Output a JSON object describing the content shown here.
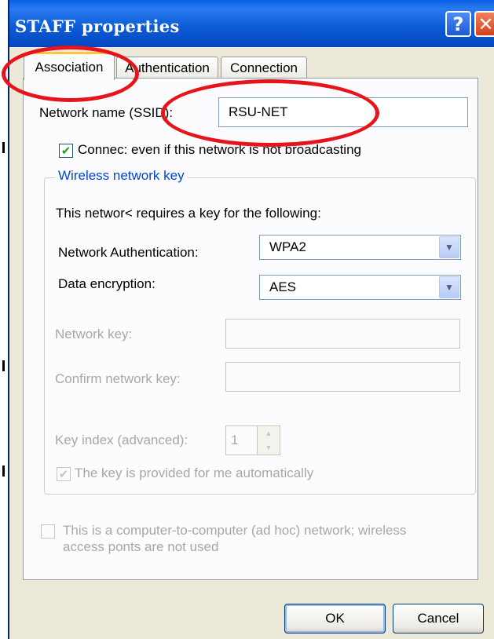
{
  "window": {
    "title": "STAFF properties",
    "help_glyph": "?",
    "close_glyph": "✕"
  },
  "tabs": [
    {
      "label": "Association",
      "active": true
    },
    {
      "label": "Authentication",
      "active": false
    },
    {
      "label": "Connection",
      "active": false
    }
  ],
  "association": {
    "ssid_label": "Network name (SSID):",
    "ssid_value": "RSU-NET",
    "connect_checkbox": {
      "label": "Connec: even if this network is not broadcasting",
      "checked": true
    },
    "key_group": {
      "title": "Wireless network key",
      "intro": "This networ< requires a key for the following:",
      "auth_label": "Network Authentication:",
      "auth_value": "WPA2",
      "encryption_label": "Data encryption:",
      "encryption_value": "AES",
      "network_key_label": "Network key:",
      "network_key_value": "",
      "confirm_key_label": "Confirm network key:",
      "confirm_key_value": "",
      "key_index_label": "Key index (advanced):",
      "key_index_value": "1",
      "auto_key_checkbox": {
        "label": "The key is provided for me automatically",
        "checked": true,
        "disabled": true
      }
    },
    "adhoc_checkbox": {
      "line1": "This is a computer-to-computer (ad hoc) network; wireless",
      "line2": "access ponts are not used",
      "checked": false,
      "disabled": true
    }
  },
  "buttons": {
    "ok": "OK",
    "cancel": "Cancel"
  },
  "annotations": {
    "color": "#e8141c"
  }
}
